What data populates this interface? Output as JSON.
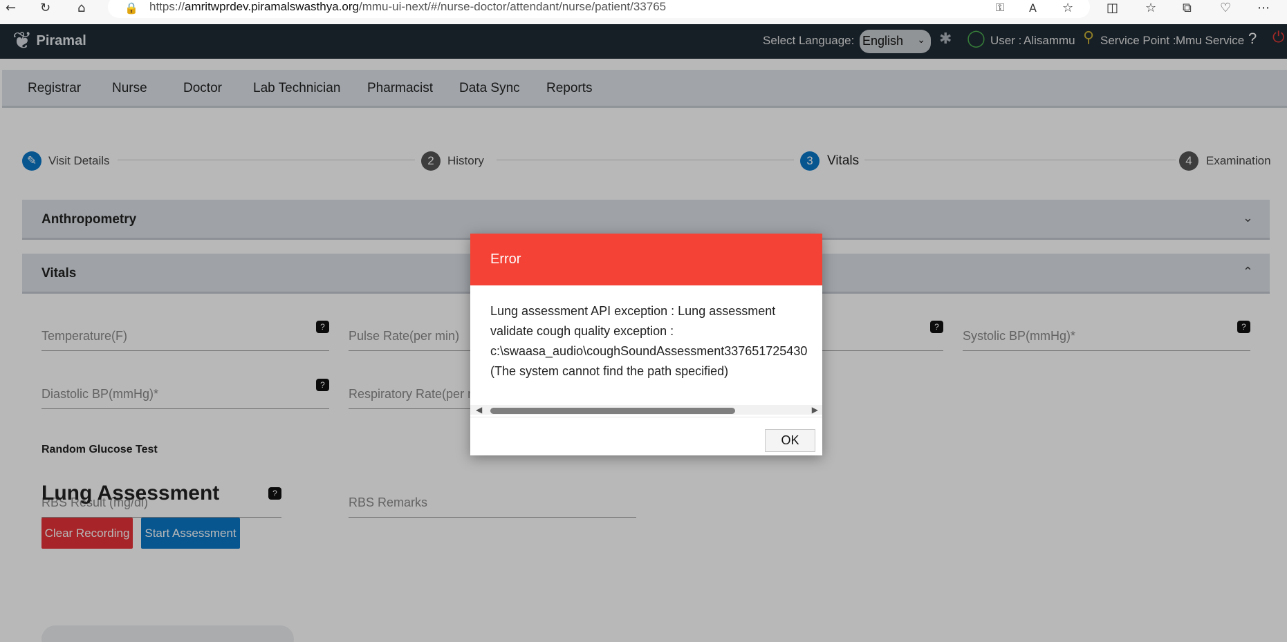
{
  "browser": {
    "url_prefix": "https://",
    "url_host": "amritwprdev.piramalswasthya.org",
    "url_path": "/mmu-ui-next/#/nurse-doctor/attendant/nurse/patient/33765",
    "icons": [
      "back-icon",
      "refresh-icon",
      "home-icon",
      "lock-icon",
      "key-icon",
      "read-aloud-icon",
      "favorite-icon",
      "split-screen-icon",
      "favorites-list-icon",
      "collections-icon",
      "extensions-icon",
      "more-icon"
    ]
  },
  "header": {
    "brand": "Piramal",
    "language_label": "Select Language:",
    "language_value": "English",
    "user_label": "User :",
    "user_name": "Alisammu",
    "service_label": "Service Point :",
    "service_name": "Mmu Service"
  },
  "nav": {
    "items": [
      "Registrar",
      "Nurse",
      "Doctor",
      "Lab Technician",
      "Pharmacist",
      "Data Sync",
      "Reports"
    ]
  },
  "stepper": {
    "steps": [
      {
        "num": "",
        "label": "Visit Details"
      },
      {
        "num": "2",
        "label": "History"
      },
      {
        "num": "3",
        "label": "Vitals"
      },
      {
        "num": "4",
        "label": "Examination"
      }
    ]
  },
  "panels": {
    "anthropometry": "Anthropometry",
    "vitals": "Vitals"
  },
  "fields": {
    "temperature": "Temperature(F)",
    "pulse_rate": "Pulse Rate(per min)",
    "systolic": "Systolic BP(mmHg)*",
    "diastolic": "Diastolic BP(mmHg)*",
    "respiratory": "Respiratory Rate(per m",
    "rbs_result": "RBS Result (mg/dl)",
    "rbs_remarks": "RBS Remarks"
  },
  "glucose_label": "Random Glucose Test",
  "lung": {
    "title": "Lung Assessment",
    "clear_btn": "Clear Recording",
    "start_btn": "Start Assessment"
  },
  "dialog": {
    "title": "Error",
    "line1": "Lung assessment API exception : Lung assessment",
    "line2": "validate cough quality exception :",
    "line3": "c:\\swaasa_audio\\coughSoundAssessment337651725430",
    "line4": "(The system cannot find the path specified)",
    "ok": "OK"
  },
  "colors": {
    "header_bg": "#1f2b35",
    "error_red": "#f44336",
    "accent_blue": "#0b78c8"
  }
}
